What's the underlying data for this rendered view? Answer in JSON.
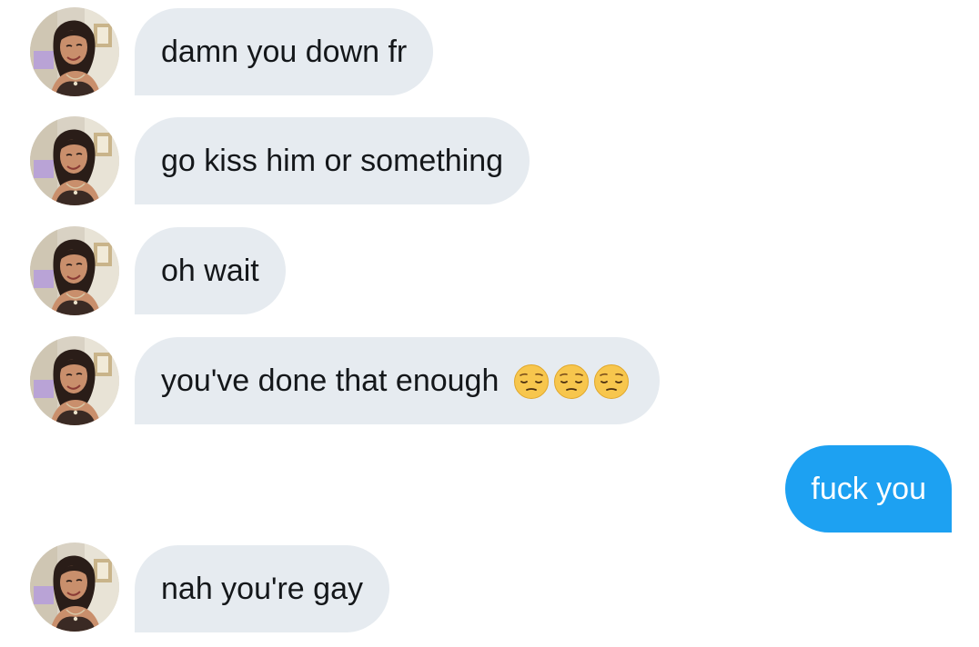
{
  "conversation": {
    "messages": [
      {
        "text": "damn you down fr",
        "direction": "incoming",
        "emoji": []
      },
      {
        "text": "go kiss him or something",
        "direction": "incoming",
        "emoji": []
      },
      {
        "text": "oh wait",
        "direction": "incoming",
        "emoji": []
      },
      {
        "text": "you've done that enough",
        "direction": "incoming",
        "emoji": [
          "pensive-face",
          "pensive-face",
          "pensive-face"
        ]
      },
      {
        "text": "fuck you",
        "direction": "outgoing",
        "emoji": []
      },
      {
        "text": "nah you're gay",
        "direction": "incoming",
        "emoji": []
      }
    ]
  },
  "colors": {
    "incoming_bubble": "#e6ebf0",
    "outgoing_bubble": "#1da1f2",
    "incoming_text": "#14171a",
    "outgoing_text": "#ffffff"
  },
  "icons": {
    "avatar": "contact-avatar-photo",
    "emoji": "pensive-face-emoji"
  }
}
